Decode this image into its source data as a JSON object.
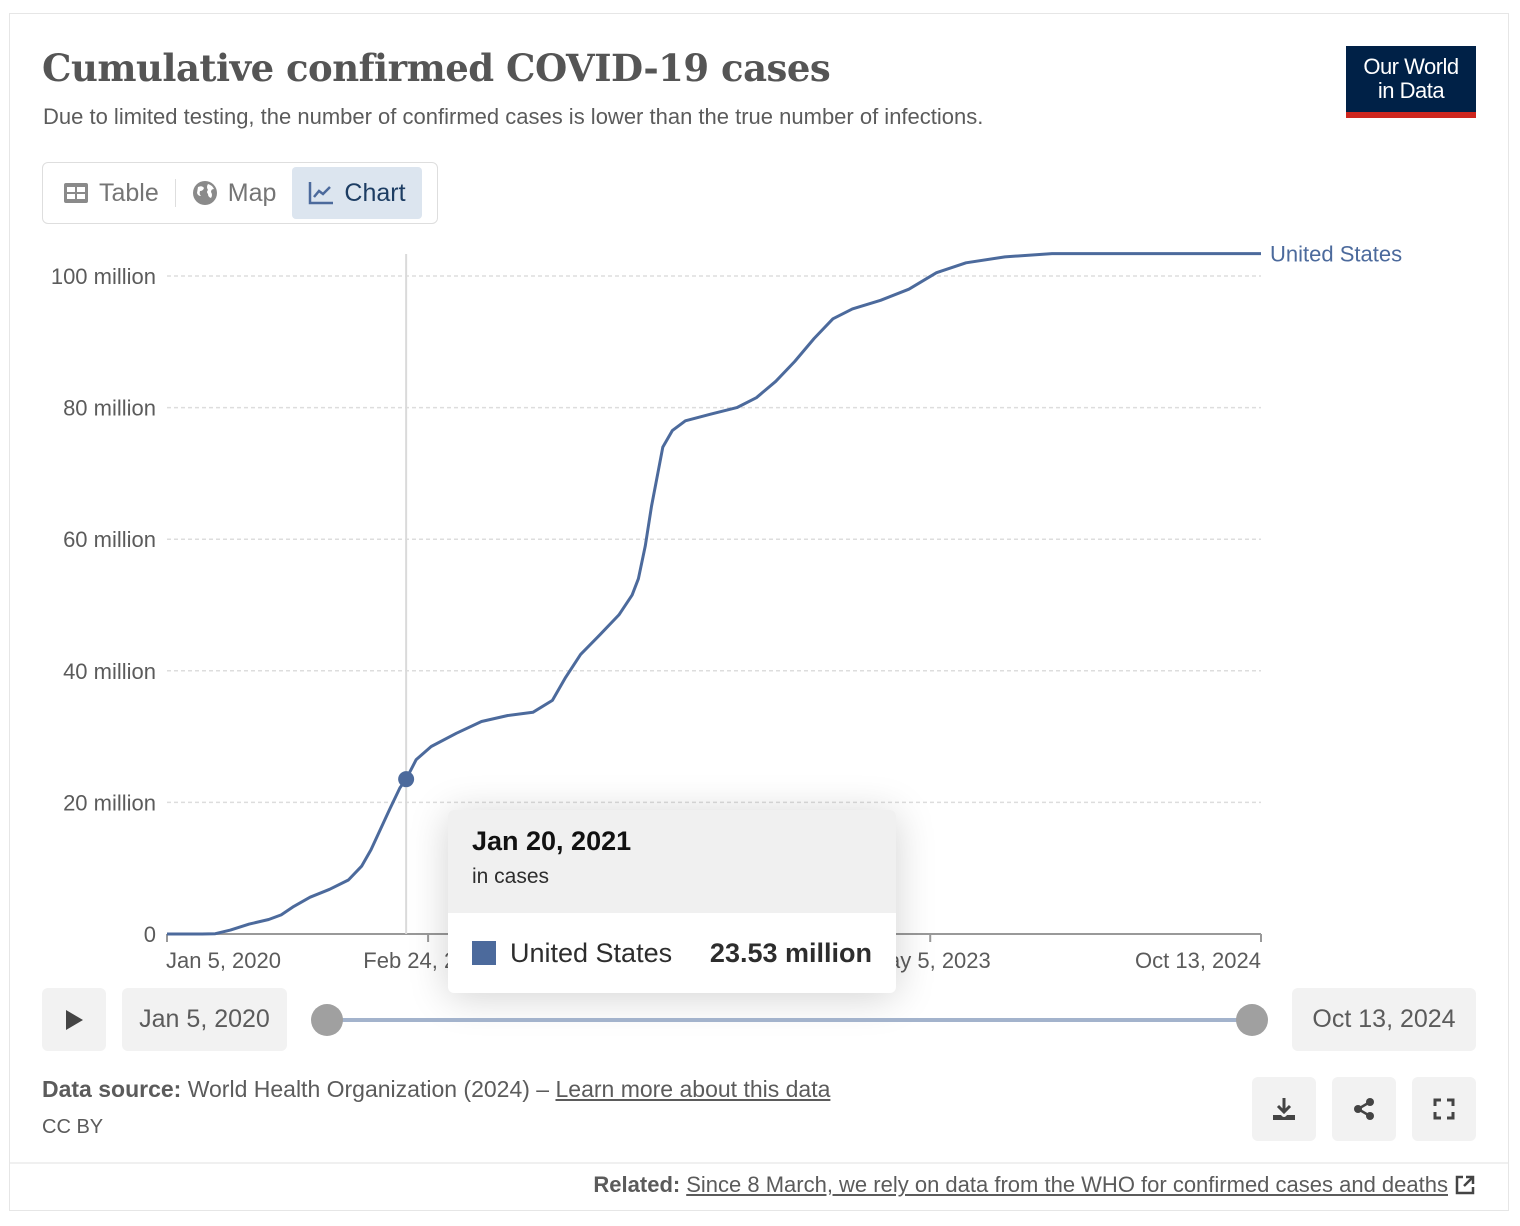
{
  "header": {
    "title": "Cumulative confirmed COVID-19 cases",
    "subtitle": "Due to limited testing, the number of confirmed cases is lower than the true number of infections.",
    "logo_line1": "Our World",
    "logo_line2": "in Data"
  },
  "tabs": [
    {
      "label": "Table",
      "icon": "table-icon",
      "active": false
    },
    {
      "label": "Map",
      "icon": "globe-icon",
      "active": false
    },
    {
      "label": "Chart",
      "icon": "line-chart-icon",
      "active": true
    }
  ],
  "colors": {
    "series": "#4c6a9c",
    "logo_bg": "#002147",
    "logo_accent": "#ce261e",
    "active_tab_bg": "#dce5ef"
  },
  "chart_data": {
    "type": "line",
    "title": "Cumulative confirmed COVID-19 cases",
    "xlabel": "",
    "ylabel": "",
    "ylim": [
      0,
      100000000
    ],
    "grid": "horizontal-dashed",
    "legend": "right-end-label",
    "y_ticks": [
      {
        "value": 0,
        "label": "0"
      },
      {
        "value": 20000000,
        "label": "20 million"
      },
      {
        "value": 40000000,
        "label": "40 million"
      },
      {
        "value": 60000000,
        "label": "60 million"
      },
      {
        "value": 80000000,
        "label": "80 million"
      },
      {
        "value": 100000000,
        "label": "100 million"
      }
    ],
    "x_range": [
      "2020-01-05",
      "2024-10-13"
    ],
    "x_ticks": [
      {
        "date": "2020-01-05",
        "label": "Jan 5, 2020"
      },
      {
        "date": "2021-02-24",
        "label": "Feb 24, 2021"
      },
      {
        "date": "2023-05-05",
        "label": "May 5, 2023"
      },
      {
        "date": "2024-10-13",
        "label": "Oct 13, 2024"
      }
    ],
    "series": [
      {
        "name": "United States",
        "color": "#4c6a9c",
        "points": [
          [
            "2020-01-05",
            0
          ],
          [
            "2020-03-01",
            0
          ],
          [
            "2020-03-22",
            50000
          ],
          [
            "2020-04-15",
            600000
          ],
          [
            "2020-05-15",
            1500000
          ],
          [
            "2020-06-15",
            2200000
          ],
          [
            "2020-07-05",
            2900000
          ],
          [
            "2020-07-25",
            4200000
          ],
          [
            "2020-08-20",
            5600000
          ],
          [
            "2020-09-20",
            6800000
          ],
          [
            "2020-10-20",
            8200000
          ],
          [
            "2020-11-10",
            10300000
          ],
          [
            "2020-11-25",
            12800000
          ],
          [
            "2020-12-10",
            15900000
          ],
          [
            "2020-12-25",
            19000000
          ],
          [
            "2021-01-10",
            22200000
          ],
          [
            "2021-01-20",
            23530000
          ],
          [
            "2021-02-05",
            26500000
          ],
          [
            "2021-03-01",
            28500000
          ],
          [
            "2021-04-10",
            30500000
          ],
          [
            "2021-05-20",
            32300000
          ],
          [
            "2021-07-01",
            33200000
          ],
          [
            "2021-08-10",
            33700000
          ],
          [
            "2021-09-10",
            35500000
          ],
          [
            "2021-10-01",
            39000000
          ],
          [
            "2021-10-25",
            42500000
          ],
          [
            "2021-11-25",
            45500000
          ],
          [
            "2021-12-25",
            48500000
          ],
          [
            "2022-01-15",
            51500000
          ],
          [
            "2022-01-25",
            54000000
          ],
          [
            "2022-02-05",
            59000000
          ],
          [
            "2022-02-15",
            65000000
          ],
          [
            "2022-02-25",
            70000000
          ],
          [
            "2022-03-05",
            74000000
          ],
          [
            "2022-03-20",
            76500000
          ],
          [
            "2022-04-10",
            78000000
          ],
          [
            "2022-05-20",
            79000000
          ],
          [
            "2022-07-01",
            80000000
          ],
          [
            "2022-08-01",
            81500000
          ],
          [
            "2022-09-01",
            84000000
          ],
          [
            "2022-10-01",
            87000000
          ],
          [
            "2022-11-01",
            90500000
          ],
          [
            "2022-12-01",
            93500000
          ],
          [
            "2023-01-01",
            95000000
          ],
          [
            "2023-02-15",
            96300000
          ],
          [
            "2023-04-01",
            98000000
          ],
          [
            "2023-05-15",
            100500000
          ],
          [
            "2023-07-01",
            102000000
          ],
          [
            "2023-09-01",
            102900000
          ],
          [
            "2023-11-15",
            103400000
          ],
          [
            "2024-10-13",
            103400000
          ]
        ]
      }
    ],
    "hover": {
      "date": "2021-01-20",
      "date_label": "Jan 20, 2021",
      "subtitle": "in cases",
      "entity": "United States",
      "value": 23530000,
      "value_label": "23.53 million"
    }
  },
  "timeline": {
    "start_label": "Jan 5, 2020",
    "end_label": "Oct 13, 2024",
    "start_fraction": 0,
    "end_fraction": 1
  },
  "footer": {
    "source_label": "Data source:",
    "source_text": " World Health Organization (2024) – ",
    "learn_more": "Learn more about this data",
    "license": "CC BY",
    "related_label": "Related:",
    "related_link": "Since 8 March, we rely on data from the WHO for confirmed cases and deaths"
  },
  "actions": [
    {
      "name": "download",
      "icon": "download-icon"
    },
    {
      "name": "share",
      "icon": "share-icon"
    },
    {
      "name": "fullscreen",
      "icon": "fullscreen-icon"
    }
  ]
}
